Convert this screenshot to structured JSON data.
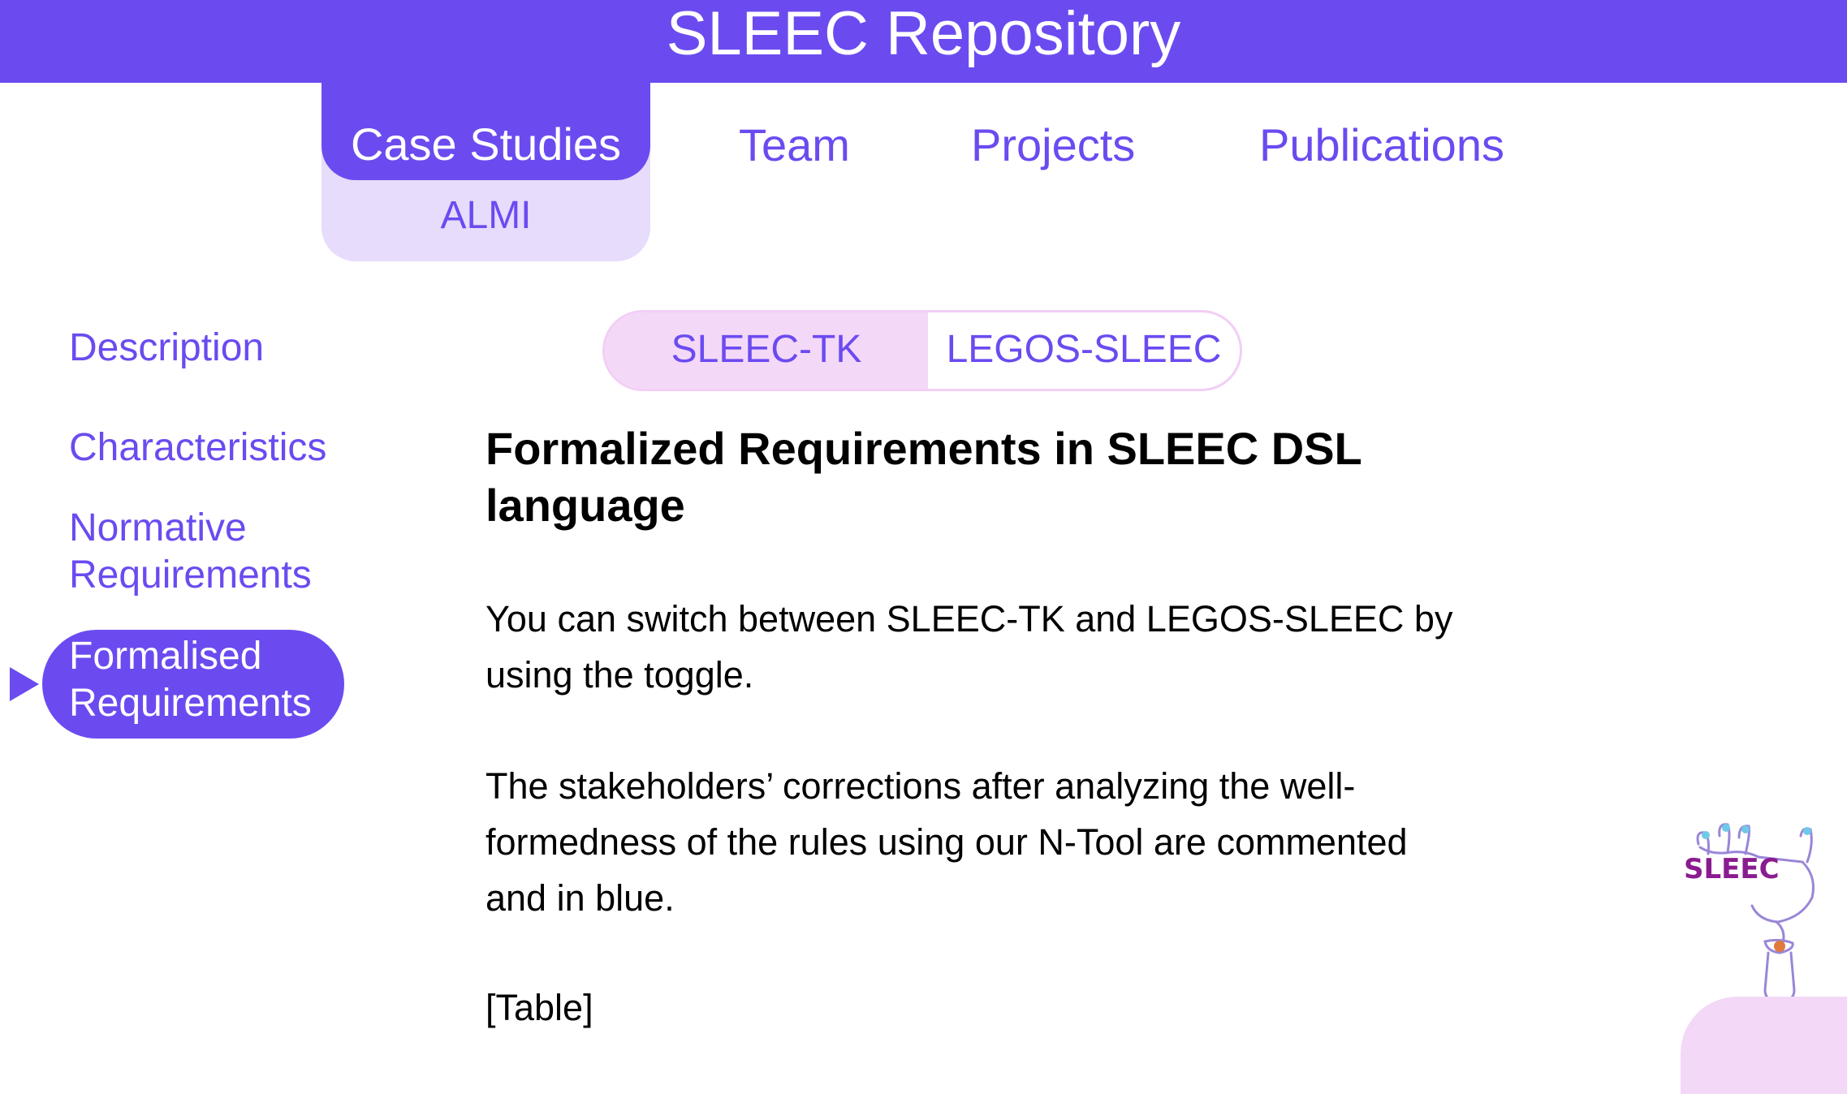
{
  "header": {
    "title": "SLEEC Repository"
  },
  "nav": {
    "case_studies": "Case Studies",
    "case_studies_sub": "ALMI",
    "team": "Team",
    "projects": "Projects",
    "publications": "Publications"
  },
  "sidebar": {
    "items": [
      {
        "label": "Description"
      },
      {
        "label": "Characteristics"
      },
      {
        "label": "Normative Requirements",
        "line1": "Normative",
        "line2": "Requirements"
      },
      {
        "label": "Formalised Requirements",
        "line1": "Formalised",
        "line2": "Requirements",
        "active": true
      }
    ]
  },
  "toggle": {
    "left": "SLEEC-TK",
    "right": "LEGOS-SLEEC",
    "selected": "SLEEC-TK"
  },
  "content": {
    "heading": "Formalized Requirements in SLEEC DSL language",
    "paragraph1": "You can switch between SLEEC-TK and LEGOS-SLEEC by using the toggle.",
    "paragraph2": "The stakeholders’ corrections after analyzing the well-formedness of the rules using our N-Tool are commented and in blue.",
    "table_placeholder": "[Table]"
  },
  "logo": {
    "text": "SLEEC"
  },
  "colors": {
    "brand": "#6b4bf0",
    "brand_light": "#e7dcfb",
    "toggle_bg": "#f4d8f7",
    "logo_text": "#8a1c8f"
  }
}
